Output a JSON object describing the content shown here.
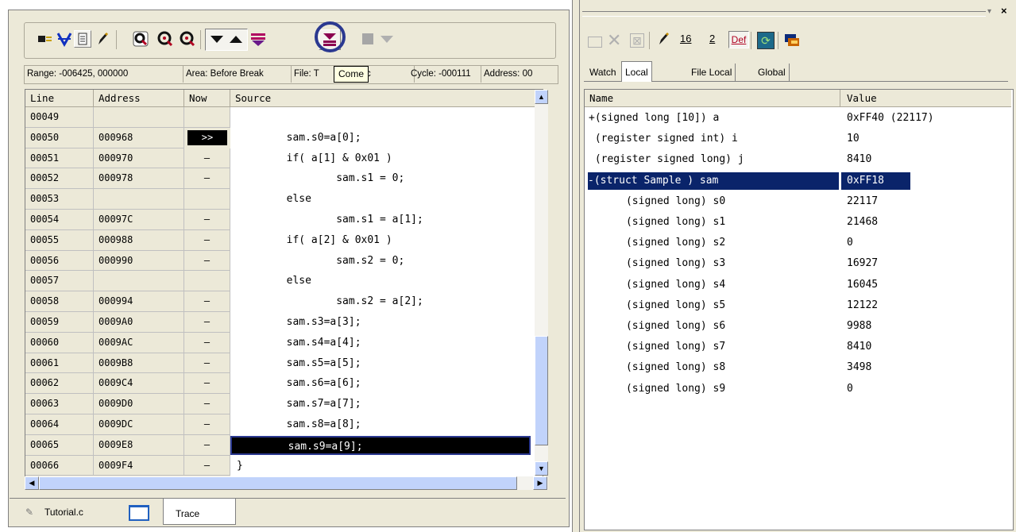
{
  "toolbar_left": {
    "tooltip": "Come",
    "buttons": [
      "select-icon",
      "filter-icon",
      "page-icon",
      "pencil-icon",
      "search-icon",
      "search-prev-icon",
      "search-next-icon",
      "arrow-down-icon",
      "arrow-up-icon",
      "jump-up-icon",
      "come-icon",
      "stop-icon",
      "disabled-down-icon"
    ]
  },
  "info_bar": {
    "range": "Range: -006425, 000000",
    "area": "Area: Before Break",
    "file": "File: T",
    "file_tail": "c",
    "cycle": "Cycle: -000111",
    "address": "Address: 00"
  },
  "trace_table": {
    "headers": {
      "line": "Line",
      "address": "Address",
      "now": "Now",
      "source": "Source"
    },
    "rows": [
      {
        "line": "00049",
        "address": "",
        "now": "",
        "source": ""
      },
      {
        "line": "00050",
        "address": "000968",
        "now": ">>",
        "source": "        sam.s0=a[0];"
      },
      {
        "line": "00051",
        "address": "000970",
        "now": "–",
        "source": "        if( a[1] & 0x01 )"
      },
      {
        "line": "00052",
        "address": "000978",
        "now": "–",
        "source": "                sam.s1 = 0;"
      },
      {
        "line": "00053",
        "address": "",
        "now": "",
        "source": "        else"
      },
      {
        "line": "00054",
        "address": "00097C",
        "now": "–",
        "source": "                sam.s1 = a[1];"
      },
      {
        "line": "00055",
        "address": "000988",
        "now": "–",
        "source": "        if( a[2] & 0x01 )"
      },
      {
        "line": "00056",
        "address": "000990",
        "now": "–",
        "source": "                sam.s2 = 0;"
      },
      {
        "line": "00057",
        "address": "",
        "now": "",
        "source": "        else"
      },
      {
        "line": "00058",
        "address": "000994",
        "now": "–",
        "source": "                sam.s2 = a[2];"
      },
      {
        "line": "00059",
        "address": "0009A0",
        "now": "–",
        "source": "        sam.s3=a[3];"
      },
      {
        "line": "00060",
        "address": "0009AC",
        "now": "–",
        "source": "        sam.s4=a[4];"
      },
      {
        "line": "00061",
        "address": "0009B8",
        "now": "–",
        "source": "        sam.s5=a[5];"
      },
      {
        "line": "00062",
        "address": "0009C4",
        "now": "–",
        "source": "        sam.s6=a[6];"
      },
      {
        "line": "00063",
        "address": "0009D0",
        "now": "–",
        "source": "        sam.s7=a[7];"
      },
      {
        "line": "00064",
        "address": "0009DC",
        "now": "–",
        "source": "        sam.s8=a[8];"
      },
      {
        "line": "00065",
        "address": "0009E8",
        "now": "–",
        "source": "        sam.s9=a[9];"
      },
      {
        "line": "00066",
        "address": "0009F4",
        "now": "–",
        "source": "}"
      }
    ]
  },
  "bottom_tabs": {
    "tutorial": "Tutorial.c",
    "trace": "Trace"
  },
  "watch_panel": {
    "tabs": [
      "Watch",
      "Local",
      "File Local",
      "Global"
    ],
    "headers": {
      "name": "Name",
      "value": "Value"
    },
    "rows": [
      {
        "name": "+(signed long [10]) a",
        "value": "0xFF40 (22117)"
      },
      {
        "name": " (register signed int) i",
        "value": "10"
      },
      {
        "name": " (register signed long) j",
        "value": "8410"
      },
      {
        "name": "-(struct Sample ) sam",
        "value": "0xFF18"
      },
      {
        "name": "      (signed long) s0",
        "value": "22117"
      },
      {
        "name": "      (signed long) s1",
        "value": "21468"
      },
      {
        "name": "      (signed long) s2",
        "value": "0"
      },
      {
        "name": "      (signed long) s3",
        "value": "16927"
      },
      {
        "name": "      (signed long) s4",
        "value": "16045"
      },
      {
        "name": "      (signed long) s5",
        "value": "12122"
      },
      {
        "name": "      (signed long) s6",
        "value": "9988"
      },
      {
        "name": "      (signed long) s7",
        "value": "8410"
      },
      {
        "name": "      (signed long) s8",
        "value": "3498"
      },
      {
        "name": "      (signed long) s9",
        "value": "0"
      }
    ],
    "toolbar": {
      "hex": "16",
      "dec": "2",
      "def": "Def"
    }
  },
  "colors": {
    "accent_circle": "#2b3990",
    "chrome": "#ece9d8",
    "selection": "#0a246a",
    "highlight": "#000000"
  }
}
